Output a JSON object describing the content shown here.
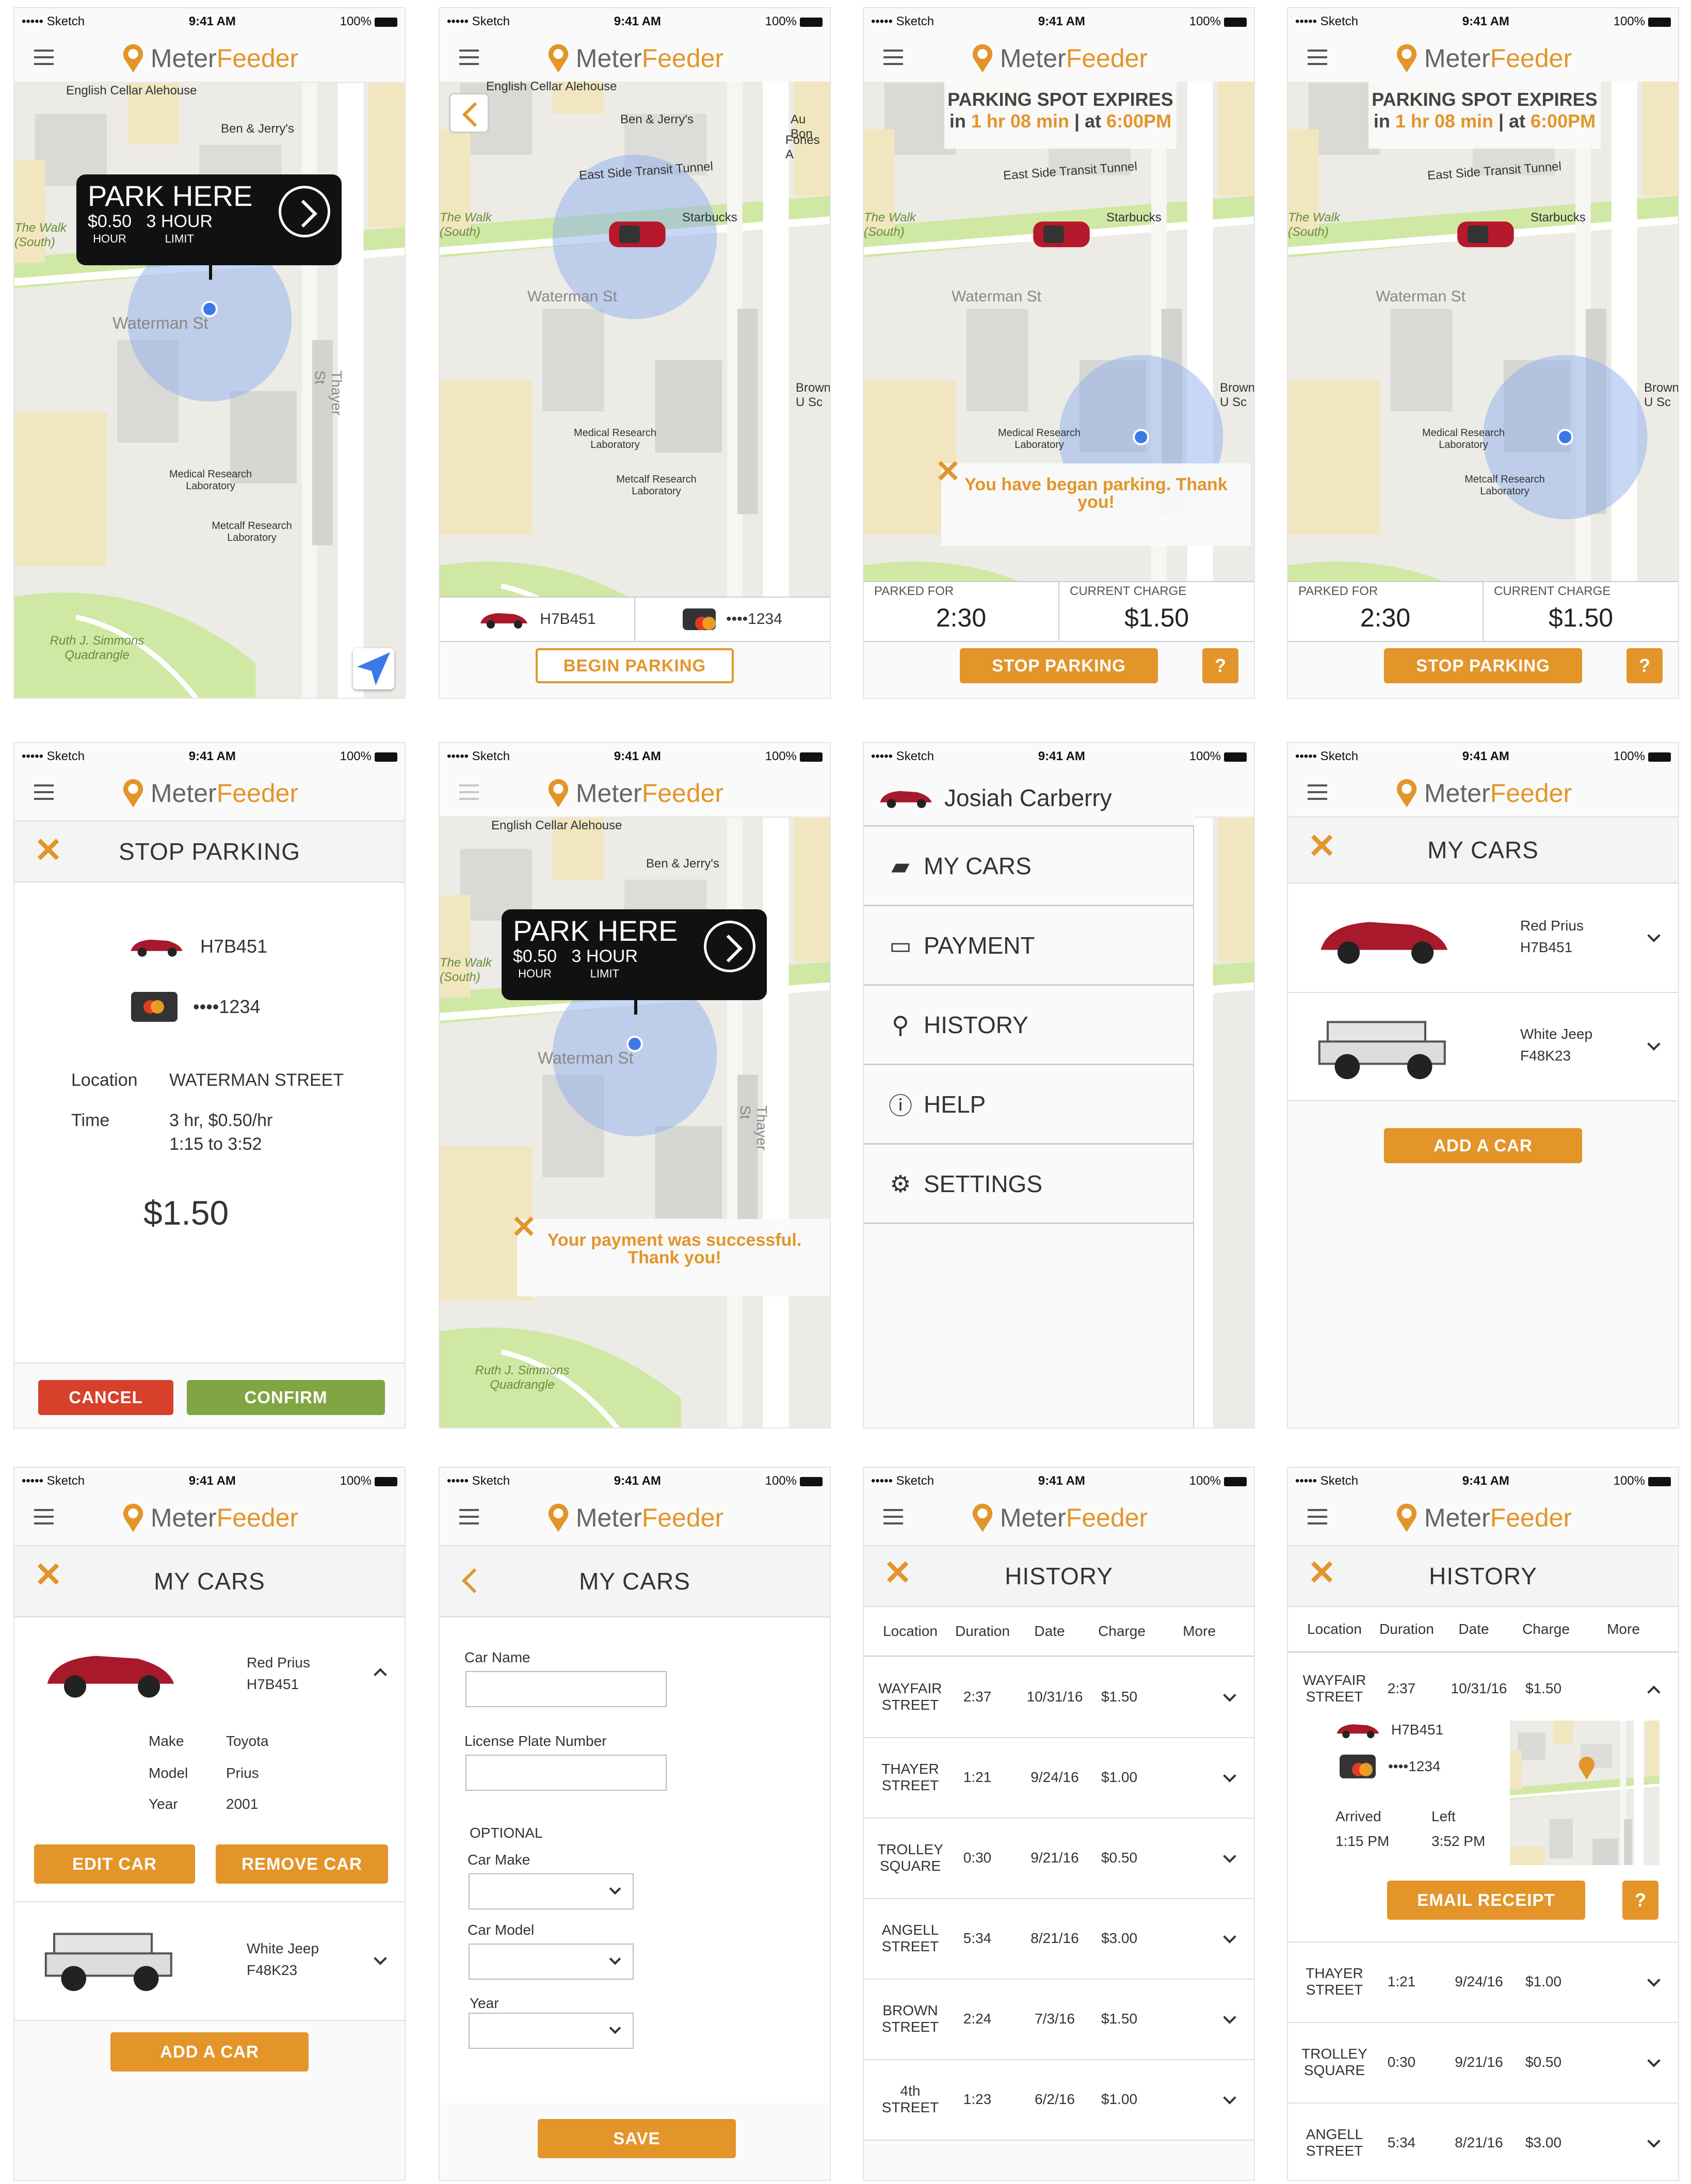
{
  "status": {
    "carrier": "••••• Sketch",
    "time": "9:41 AM",
    "battery": "100%"
  },
  "app": {
    "name_a": "Meter",
    "name_b": "Feeder"
  },
  "colors": {
    "accent": "#e3952a",
    "cancel": "#d7402a",
    "confirm": "#82a544"
  },
  "map_labels": {
    "cellar": "English Cellar Alehouse",
    "benjerry": "Ben & Jerry's",
    "waterman": "Waterman St",
    "thewalk": "The Walk (South)",
    "medical": "Medical Research Laboratory",
    "metcalf": "Metcalf Research Laboratory",
    "ruth": "Ruth J. Simmons Quadrangle",
    "transit": "East Side Transit Tunnel",
    "starbucks": "Starbucks",
    "thayer": "Thayer St",
    "aubon": "Au Bon",
    "fones": "Fones A",
    "brown": "Brown U Sc"
  },
  "park_here": {
    "title": "PARK HERE",
    "price": "$0.50",
    "price_unit": "HOUR",
    "limit": "3 HOUR",
    "limit_unit": "LIMIT"
  },
  "begin": {
    "plate": "H7B451",
    "card": "••••1234",
    "button": "BEGIN PARKING"
  },
  "active": {
    "expires_title": "PARKING SPOT EXPIRES",
    "expires_in_pre": "in ",
    "expires_in": "1 hr 08 min",
    "expires_sep": " | at ",
    "expires_at": "6:00PM",
    "toast": "You have began parking. Thank you!",
    "parked_for_label": "PARKED FOR",
    "parked_for": "2:30",
    "charge_label": "CURRENT CHARGE",
    "charge": "$1.50",
    "stop": "STOP PARKING",
    "help": "?"
  },
  "stop_parking": {
    "title": "STOP PARKING",
    "plate": "H7B451",
    "card": "••••1234",
    "location_label": "Location",
    "location": "WATERMAN STREET",
    "time_label": "Time",
    "time_rate": "3 hr, $0.50/hr",
    "time_range": "1:15 to 3:52",
    "total": "$1.50",
    "cancel": "CANCEL",
    "confirm": "CONFIRM"
  },
  "payment_toast": "Your payment was successful. Thank you!",
  "menu": {
    "user": "Josiah Carberry",
    "items": [
      {
        "label": "MY CARS",
        "icon": "car-icon"
      },
      {
        "label": "PAYMENT",
        "icon": "card-icon"
      },
      {
        "label": "HISTORY",
        "icon": "pin-icon"
      },
      {
        "label": "HELP",
        "icon": "info-icon"
      },
      {
        "label": "SETTINGS",
        "icon": "gear-icon"
      }
    ]
  },
  "my_cars": {
    "title": "MY CARS",
    "cars": [
      {
        "name": "Red Prius",
        "plate": "H7B451",
        "color": "#a8192b"
      },
      {
        "name": "White Jeep",
        "plate": "F48K23",
        "color": "#dddddd"
      }
    ],
    "add": "ADD A CAR"
  },
  "car_detail": {
    "make_label": "Make",
    "make": "Toyota",
    "model_label": "Model",
    "model": "Prius",
    "year_label": "Year",
    "year": "2001",
    "edit": "EDIT CAR",
    "remove": "REMOVE CAR"
  },
  "add_car": {
    "title": "MY CARS",
    "name_label": "Car Name",
    "plate_label": "License Plate Number",
    "optional": "OPTIONAL",
    "make_label": "Car Make",
    "model_label": "Car Model",
    "year_label": "Year",
    "save": "SAVE"
  },
  "history": {
    "title": "HISTORY",
    "headers": [
      "Location",
      "Duration",
      "Date",
      "Charge",
      "More"
    ],
    "rows": [
      {
        "loc1": "WAYFAIR",
        "loc2": "STREET",
        "dur": "2:37",
        "date": "10/31/16",
        "charge": "$1.50"
      },
      {
        "loc1": "THAYER",
        "loc2": "STREET",
        "dur": "1:21",
        "date": "9/24/16",
        "charge": "$1.00"
      },
      {
        "loc1": "TROLLEY",
        "loc2": "SQUARE",
        "dur": "0:30",
        "date": "9/21/16",
        "charge": "$0.50"
      },
      {
        "loc1": "ANGELL",
        "loc2": "STREET",
        "dur": "5:34",
        "date": "8/21/16",
        "charge": "$3.00"
      },
      {
        "loc1": "BROWN",
        "loc2": "STREET",
        "dur": "2:24",
        "date": "7/3/16",
        "charge": "$1.50"
      },
      {
        "loc1": "4th",
        "loc2": "STREET",
        "dur": "1:23",
        "date": "6/2/16",
        "charge": "$1.00"
      }
    ],
    "expanded": {
      "plate": "H7B451",
      "card": "••••1234",
      "arrived_label": "Arrived",
      "arrived": "1:15 PM",
      "left_label": "Left",
      "left": "3:52 PM",
      "email": "EMAIL RECEIPT",
      "help": "?"
    }
  }
}
